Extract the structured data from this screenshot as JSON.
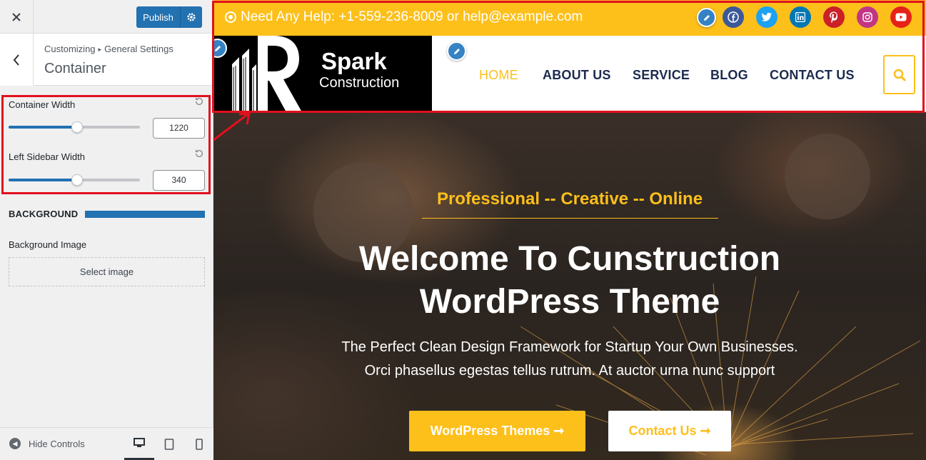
{
  "customizer": {
    "publish_label": "Publish",
    "breadcrumb": [
      "Customizing",
      "General Settings"
    ],
    "section_title": "Container",
    "container_width": {
      "label": "Container Width",
      "value": "1220",
      "fraction": 0.52
    },
    "left_sidebar_width": {
      "label": "Left Sidebar Width",
      "value": "340",
      "fraction": 0.52
    },
    "background_heading": "BACKGROUND",
    "background_image_label": "Background Image",
    "select_image_label": "Select image",
    "hide_controls_label": "Hide Controls"
  },
  "preview": {
    "topbar_text": "Need Any Help: +1-559-236-8009 or help@example.com",
    "social_icons": [
      {
        "name": "facebook-icon",
        "color": "#3b5998"
      },
      {
        "name": "twitter-icon",
        "color": "#1da1f2"
      },
      {
        "name": "linkedin-icon",
        "color": "#0077b5"
      },
      {
        "name": "pinterest-icon",
        "color": "#cb2027"
      },
      {
        "name": "instagram-icon",
        "color": "#c13584"
      },
      {
        "name": "youtube-icon",
        "color": "#e62117"
      }
    ],
    "logo_title": "Spark",
    "logo_subtitle": "Construction",
    "nav": [
      "HOME",
      "ABOUT US",
      "SERVICE",
      "BLOG",
      "CONTACT US"
    ],
    "active_nav": "HOME",
    "hero_subtitle": "Professional -- Creative -- Online",
    "hero_title_line1": "Welcome To Cunstruction",
    "hero_title_line2": "WordPress Theme",
    "hero_desc_line1": "The Perfect Clean Design Framework for Startup Your Own Businesses.",
    "hero_desc_line2": "Orci phasellus egestas tellus rutrum. At auctor urna nunc support",
    "btn_primary": "WordPress Themes ➞",
    "btn_secondary": "Contact Us ➞"
  },
  "colors": {
    "accent": "#fdbf1a",
    "wp_blue": "#2271b1",
    "highlight_red": "#e2101d",
    "nav_text": "#1d2b4f"
  }
}
